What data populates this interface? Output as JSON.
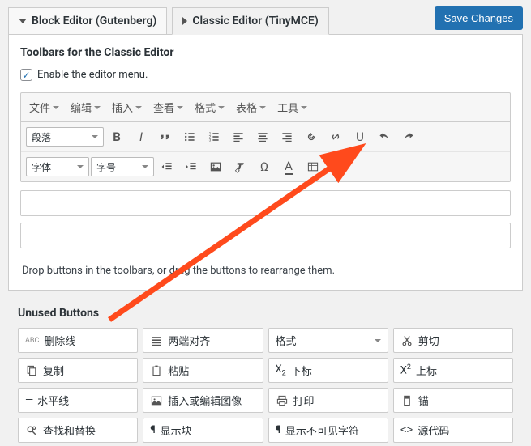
{
  "header": {
    "tab1": "Block Editor (Gutenberg)",
    "tab2": "Classic Editor (TinyMCE)",
    "save": "Save Changes"
  },
  "section": {
    "title": "Toolbars for the Classic Editor",
    "checkbox_label": "Enable the editor menu."
  },
  "menus": [
    "文件",
    "编辑",
    "插入",
    "查看",
    "格式",
    "表格",
    "工具"
  ],
  "dropdowns": {
    "paragraph": "段落",
    "font_family": "字体",
    "font_size": "字号"
  },
  "hint": "Drop buttons in the toolbars, or drag the buttons to rearrange them.",
  "unused_title": "Unused Buttons",
  "unused": {
    "strike": "删除线",
    "justify": "两端对齐",
    "format": "格式",
    "cut": "剪切",
    "copy": "复制",
    "paste": "粘贴",
    "subscript": "下标",
    "superscript": "上标",
    "hr": "水平线",
    "image": "插入或编辑图像",
    "print": "打印",
    "anchor": "锚",
    "findreplace": "查找和替换",
    "showblocks": "显示块",
    "visualchars": "显示不可见字符",
    "code": "源代码"
  }
}
